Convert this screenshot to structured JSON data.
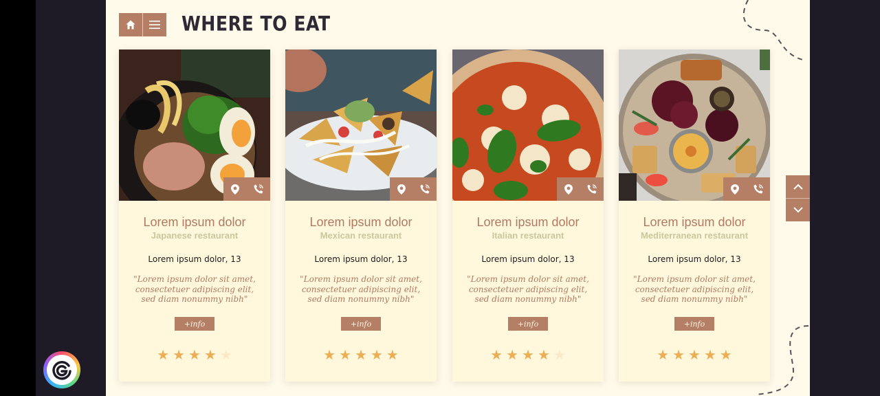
{
  "header": {
    "title": "WHERE TO EAT"
  },
  "nav": {
    "home_icon": "home-icon",
    "menu_icon": "menu-icon"
  },
  "actions": {
    "location_icon": "location-pin-icon",
    "phone_icon": "phone-icon"
  },
  "cards": [
    {
      "image": "ramen-bowl-photo",
      "name": "Lorem ipsum dolor",
      "type": "Japanese restaurant",
      "address": "Lorem ipsum dolor, 13",
      "quote": "\"Lorem ipsum dolor sit amet, consectetuer adipiscing elit, sed diam nonummy nibh\"",
      "info_label": "+info",
      "rating": 4,
      "rating_max": 5
    },
    {
      "image": "nachos-plate-photo",
      "name": "Lorem ipsum dolor",
      "type": "Mexican restaurant",
      "address": "Lorem ipsum dolor, 13",
      "quote": "\"Lorem ipsum dolor sit amet, consectetuer adipiscing elit, sed diam nonummy nibh\"",
      "info_label": "+info",
      "rating": 5,
      "rating_max": 5
    },
    {
      "image": "margherita-pizza-photo",
      "name": "Lorem ipsum dolor",
      "type": "Italian restaurant",
      "address": "Lorem ipsum dolor, 13",
      "quote": "\"Lorem ipsum dolor sit amet, consectetuer adipiscing elit, sed diam nonummy nibh\"",
      "info_label": "+info",
      "rating": 4,
      "rating_max": 5
    },
    {
      "image": "mezze-platter-photo",
      "name": "Lorem ipsum dolor",
      "type": "Mediterranean restaurant",
      "address": "Lorem ipsum dolor, 13",
      "quote": "\"Lorem ipsum dolor sit amet, consectetuer adipiscing elit, sed diam nonummy nibh\"",
      "info_label": "+info",
      "rating": 5,
      "rating_max": 5
    }
  ],
  "scroll": {
    "up_icon": "chevron-up-icon",
    "down_icon": "chevron-down-icon"
  },
  "colors": {
    "accent": "#b57f66",
    "background": "#fffaea",
    "card": "#fff8dc",
    "star": "#ecad55",
    "star_empty": "#fbe9c6",
    "subtitle": "#c9c79b"
  }
}
